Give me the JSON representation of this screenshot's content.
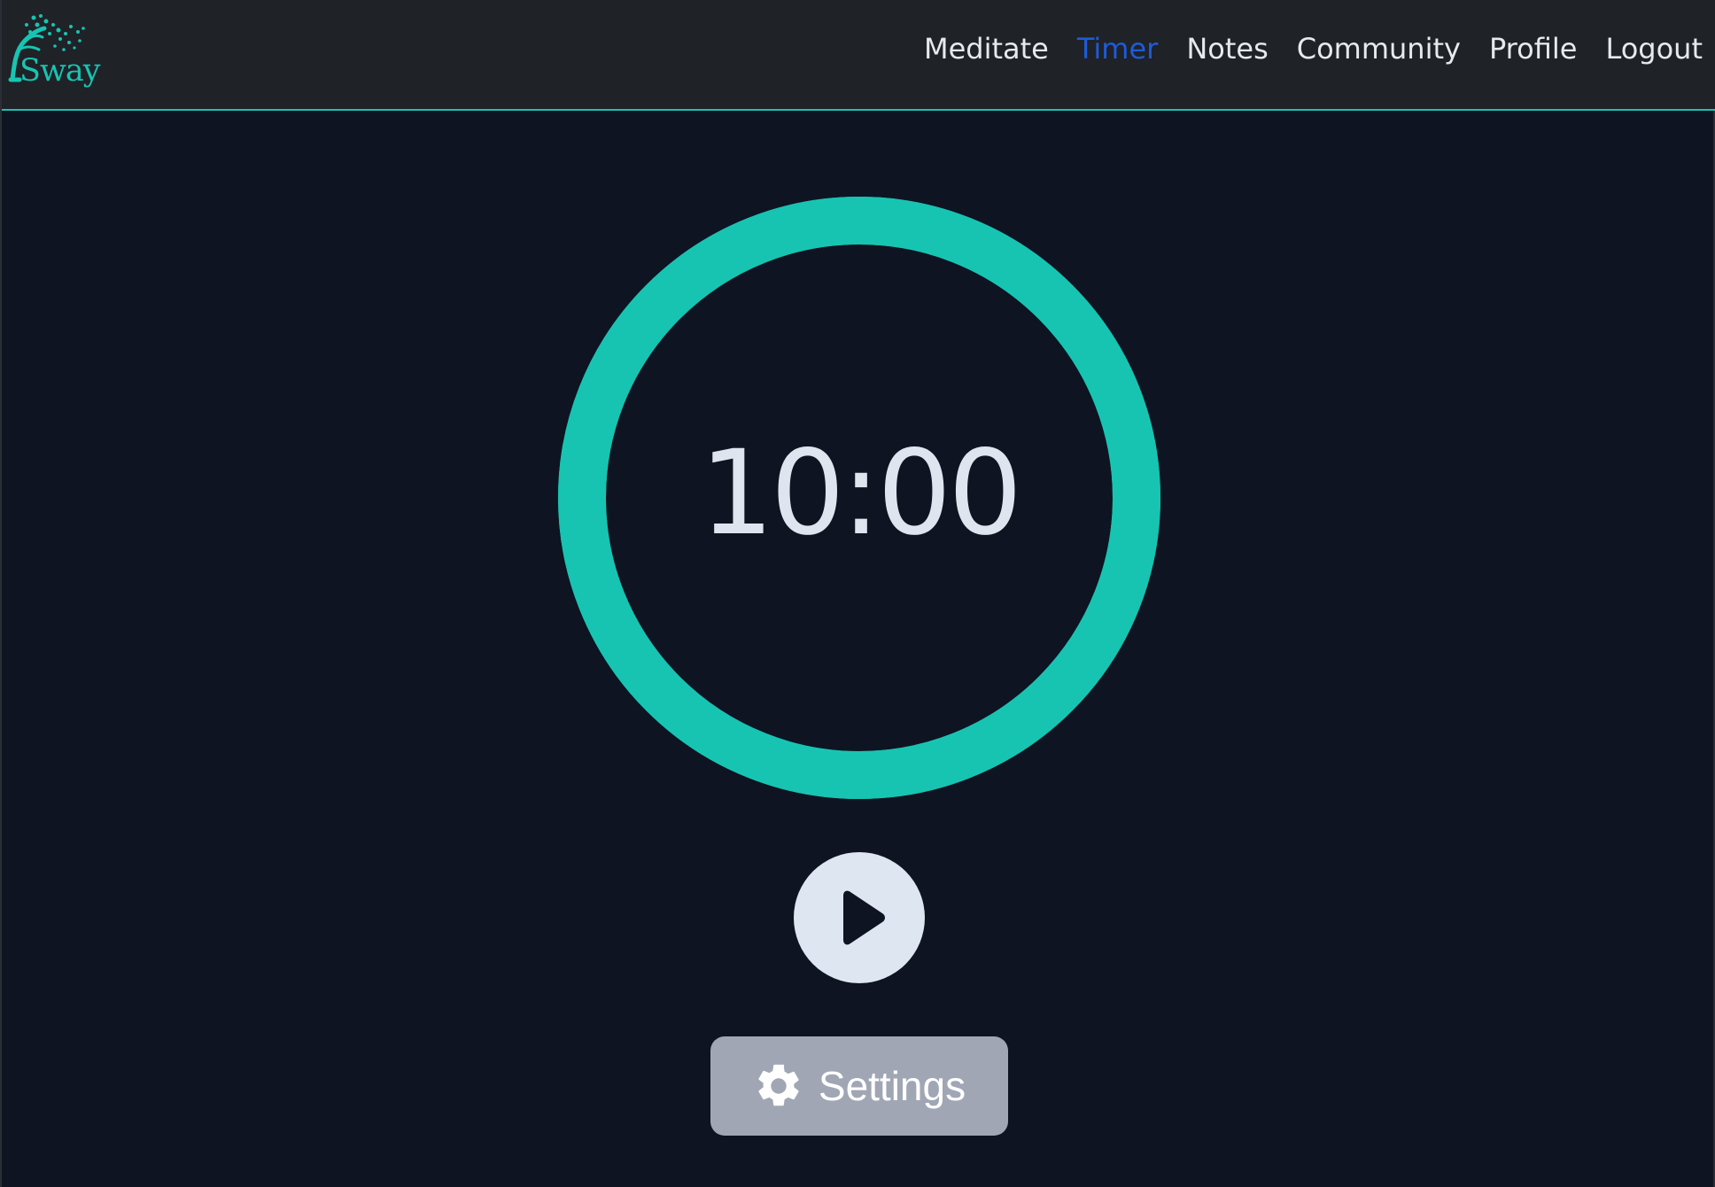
{
  "app": {
    "logo_text": "Sway",
    "accent_color": "#17c4b2",
    "active_color": "#1e5bd8"
  },
  "nav": {
    "items": [
      {
        "label": "Meditate",
        "active": false
      },
      {
        "label": "Timer",
        "active": true
      },
      {
        "label": "Notes",
        "active": false
      },
      {
        "label": "Community",
        "active": false
      },
      {
        "label": "Profile",
        "active": false
      },
      {
        "label": "Logout",
        "active": false
      }
    ]
  },
  "timer": {
    "display": "10:00",
    "progress": 1.0,
    "ring_color": "#17c4b2"
  },
  "controls": {
    "play_icon": "play-icon",
    "settings_icon": "gear-icon",
    "settings_label": "Settings"
  }
}
